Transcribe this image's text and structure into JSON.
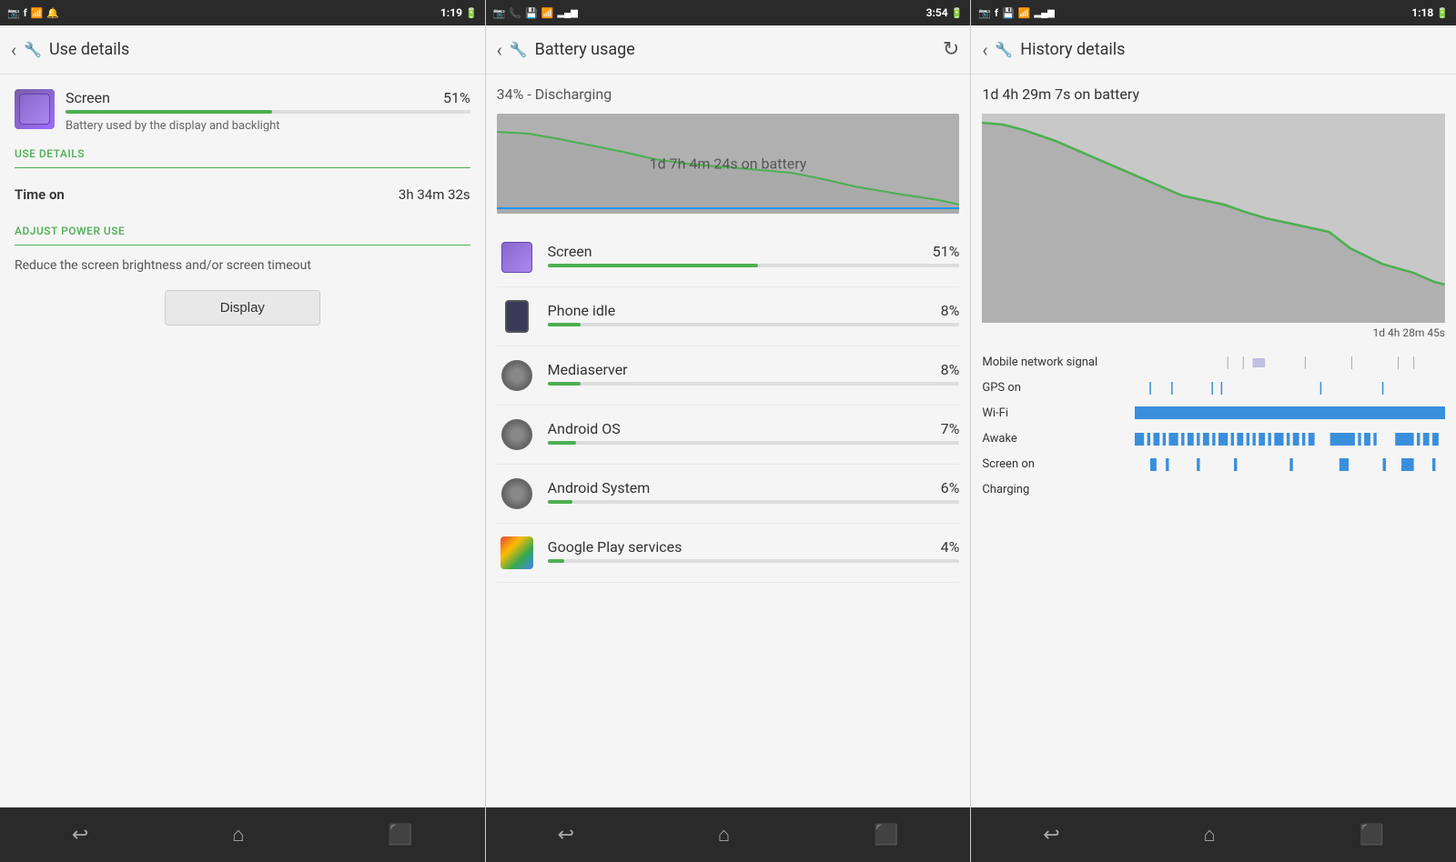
{
  "screens": [
    {
      "id": "use-details",
      "statusBar": {
        "leftIcons": [
          "📷",
          "f",
          "📶",
          "🔔"
        ],
        "time": "1:19",
        "rightIcons": [
          "battery"
        ]
      },
      "topBar": {
        "backLabel": "‹",
        "icon": "🔧",
        "title": "Use details"
      },
      "item": {
        "name": "Screen",
        "percent": "51%",
        "progress": 51,
        "description": "Battery used by the display and backlight"
      },
      "sections": [
        {
          "label": "USE DETAILS",
          "rows": [
            {
              "key": "Time on",
              "value": "3h 34m 32s"
            }
          ]
        },
        {
          "label": "ADJUST POWER USE",
          "description": "Reduce the screen brightness and/or\nscreen timeout",
          "buttonLabel": "Display"
        }
      ],
      "navIcons": [
        "↩",
        "⌂",
        "⬛"
      ]
    },
    {
      "id": "battery-usage",
      "statusBar": {
        "leftIcons": [
          "📷",
          "📞",
          "💾"
        ],
        "time": "3:54",
        "rightIcons": [
          "battery"
        ]
      },
      "topBar": {
        "backLabel": "‹",
        "icon": "🔧",
        "title": "Battery usage",
        "refreshIcon": "↻"
      },
      "chargingStatus": "34% - Discharging",
      "chartLabel": "1d 7h 4m 24s on battery",
      "items": [
        {
          "name": "Screen",
          "percent": "51%",
          "progress": 51,
          "iconType": "screen"
        },
        {
          "name": "Phone idle",
          "percent": "8%",
          "progress": 8,
          "iconType": "phone"
        },
        {
          "name": "Mediaserver",
          "percent": "8%",
          "progress": 8,
          "iconType": "gear"
        },
        {
          "name": "Android OS",
          "percent": "7%",
          "progress": 7,
          "iconType": "gear"
        },
        {
          "name": "Android System",
          "percent": "6%",
          "progress": 6,
          "iconType": "gear"
        },
        {
          "name": "Google Play services",
          "percent": "4%",
          "progress": 4,
          "iconType": "play"
        }
      ],
      "navIcons": [
        "↩",
        "⌂",
        "⬛"
      ]
    },
    {
      "id": "history-details",
      "statusBar": {
        "leftIcons": [
          "📷",
          "f",
          "💾"
        ],
        "time": "1:18",
        "rightIcons": [
          "battery"
        ]
      },
      "topBar": {
        "backLabel": "‹",
        "icon": "🔧",
        "title": "History details"
      },
      "headerText": "1d 4h 29m 7s on battery",
      "chartDuration": "1d 4h 28m 45s",
      "signals": [
        {
          "label": "Mobile network signal",
          "type": "random-ticks"
        },
        {
          "label": "GPS on",
          "type": "sparse-ticks"
        },
        {
          "label": "Wi-Fi",
          "type": "full-bar"
        },
        {
          "label": "Awake",
          "type": "dense-ticks"
        },
        {
          "label": "Screen on",
          "type": "medium-ticks"
        },
        {
          "label": "Charging",
          "type": "empty"
        }
      ],
      "navIcons": [
        "↩",
        "⌂",
        "⬛"
      ]
    }
  ]
}
